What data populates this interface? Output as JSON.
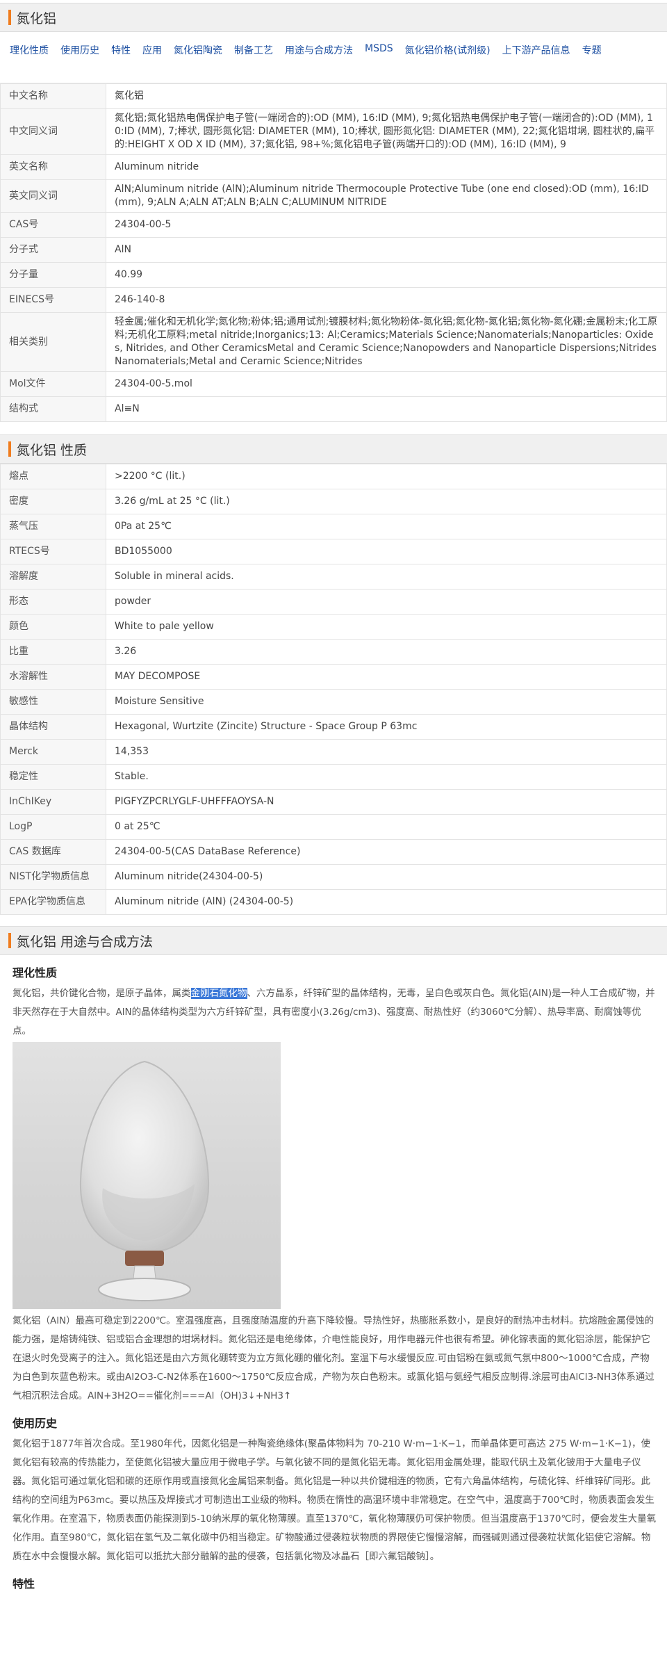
{
  "header": {
    "title": "氮化铝"
  },
  "nav": {
    "links": [
      "理化性质",
      "使用历史",
      "特性",
      "应用",
      "氮化铝陶瓷",
      "制备工艺",
      "用途与合成方法",
      "MSDS",
      "氮化铝价格(试剂级)",
      "上下游产品信息",
      "专题"
    ]
  },
  "basic_info": {
    "rows": [
      {
        "key": "中文名称",
        "value": "氮化铝"
      },
      {
        "key": "中文同义词",
        "value": "氮化铝;氮化铝热电偶保护电子管(一端闭合的):OD (MM), 16:ID (MM), 9;氮化铝热电偶保护电子管(一端闭合的):OD (MM), 10:ID (MM), 7;棒状, 圆形氮化铝: DIAMETER (MM), 10;棒状, 圆形氮化铝: DIAMETER (MM), 22;氮化铝坩埚, 圆柱状的,扁平的:HEIGHT X OD X ID (MM), 37;氮化铝, 98+%;氮化铝电子管(两端开口的):OD (MM), 16:ID (MM), 9"
      },
      {
        "key": "英文名称",
        "value": "Aluminum nitride"
      },
      {
        "key": "英文同义词",
        "value": "AlN;Aluminum nitride (AlN);Aluminum nitride Thermocouple Protective Tube (one end closed):OD (mm), 16:ID (mm), 9;ALN A;ALN AT;ALN B;ALN C;ALUMINUM NITRIDE"
      },
      {
        "key": "CAS号",
        "value": "24304-00-5"
      },
      {
        "key": "分子式",
        "value": "AlN"
      },
      {
        "key": "分子量",
        "value": "40.99"
      },
      {
        "key": "EINECS号",
        "value": "246-140-8"
      },
      {
        "key": "相关类别",
        "value": "轻金属;催化和无机化学;氮化物;粉体;铝;通用试剂;镀膜材料;氮化物粉体-氮化铝;氮化物-氮化铝;氮化物-氮化硼;金属粉末;化工原料;无机化工原料;metal nitride;Inorganics;13: Al;Ceramics;Materials Science;Nanomaterials;Nanoparticles: Oxides, Nitrides, and Other CeramicsMetal and Ceramic Science;Nanopowders and Nanoparticle Dispersions;NitridesNanomaterials;Metal and Ceramic Science;Nitrides"
      },
      {
        "key": "Mol文件",
        "value": "24304-00-5.mol"
      },
      {
        "key": "结构式",
        "value": "Al≡N"
      }
    ]
  },
  "properties": {
    "title": "氮化铝 性质",
    "rows": [
      {
        "key": "熔点",
        "value": ">2200 °C (lit.)"
      },
      {
        "key": "密度",
        "value": "3.26 g/mL at 25 °C (lit.)"
      },
      {
        "key": "蒸气压",
        "value": "0Pa at 25℃"
      },
      {
        "key": "RTECS号",
        "value": "BD1055000"
      },
      {
        "key": "溶解度",
        "value": "Soluble in mineral acids."
      },
      {
        "key": "形态",
        "value": "powder"
      },
      {
        "key": "颜色",
        "value": "White to pale yellow"
      },
      {
        "key": "比重",
        "value": "3.26"
      },
      {
        "key": "水溶解性",
        "value": "MAY DECOMPOSE"
      },
      {
        "key": "敏感性",
        "value": "Moisture Sensitive"
      },
      {
        "key": "晶体结构",
        "value": "Hexagonal, Wurtzite (Zincite) Structure - Space Group P 63mc"
      },
      {
        "key": "Merck",
        "value": "14,353"
      },
      {
        "key": "稳定性",
        "value": "Stable."
      },
      {
        "key": "InChIKey",
        "value": "PIGFYZPCRLYGLF-UHFFFAOYSA-N"
      },
      {
        "key": "LogP",
        "value": "0 at 25℃"
      },
      {
        "key": "CAS 数据库",
        "value": "24304-00-5(CAS DataBase Reference)"
      },
      {
        "key": "NIST化学物质信息",
        "value": "Aluminum nitride(24304-00-5)"
      },
      {
        "key": "EPA化学物质信息",
        "value": "Aluminum nitride (AlN) (24304-00-5)"
      }
    ]
  },
  "usage": {
    "title": "氮化铝 用途与合成方法",
    "h_physchem": "理化性质",
    "p1_before": "氮化铝，共价键化合物，是原子晶体，属类",
    "p1_highlight": "金刚石氮化物",
    "p1_after": "、六方晶系，纤锌矿型的晶体结构，无毒，呈白色或灰白色。氮化铝(AlN)是一种人工合成矿物，并非天然存在于大自然中。AlN的晶体结构类型为六方纤锌矿型，具有密度小(3.26g/cm3)、强度高、耐热性好（约3060℃分解）、热导率高、耐腐蚀等优点。",
    "p2": "氮化铝（AlN）最高可稳定到2200℃。室温强度高，且强度随温度的升高下降较慢。导热性好，热膨胀系数小，是良好的耐热冲击材料。抗熔融金属侵蚀的能力强，是熔铸纯铁、铝或铝合金理想的坩埚材料。氮化铝还是电绝缘体，介电性能良好，用作电器元件也很有希望。砷化镓表面的氮化铝涂层，能保护它在退火时免受离子的注入。氮化铝还是由六方氮化硼转变为立方氮化硼的催化剂。室温下与水缓慢反应.可由铝粉在氨或氮气氛中800～1000℃合成，产物为白色到灰蓝色粉末。或由Al2O3-C-N2体系在1600～1750℃反应合成，产物为灰白色粉末。或氯化铝与氨经气相反应制得.涂层可由AlCl3-NH3体系通过气相沉积法合成。AlN+3H2O==催化剂===Al（OH)3↓+NH3↑",
    "h_history": "使用历史",
    "p3": "氮化铝于1877年首次合成。至1980年代，因氮化铝是一种陶瓷绝缘体(聚晶体物料为 70-210 W·m−1·K−1，而单晶体更可高达 275 W·m−1·K−1)，使氮化铝有较高的传热能力，至使氮化铝被大量应用于微电子学。与氧化铍不同的是氮化铝无毒。氮化铝用金属处理，能取代矾土及氧化铍用于大量电子仪器。氮化铝可通过氧化铝和碳的还原作用或直接氮化金属铝来制备。氮化铝是一种以共价键相连的物质，它有六角晶体结构，与硫化锌、纤维锌矿同形。此结构的空间组为P63mc。要以热压及焊接式才可制造出工业级的物料。物质在惰性的高温环境中非常稳定。在空气中，温度高于700℃时，物质表面会发生氧化作用。在室温下，物质表面仍能探测到5-10纳米厚的氧化物薄膜。直至1370℃，氧化物薄膜仍可保护物质。但当温度高于1370℃时，便会发生大量氧化作用。直至980℃，氮化铝在氢气及二氧化碳中仍相当稳定。矿物酸通过侵袭粒状物质的界限使它慢慢溶解，而强碱则通过侵袭粒状氮化铝使它溶解。物质在水中会慢慢水解。氮化铝可以抵抗大部分融解的盐的侵袭，包括氯化物及冰晶石［即六氟铝酸钠］。",
    "h_features": "特性"
  }
}
